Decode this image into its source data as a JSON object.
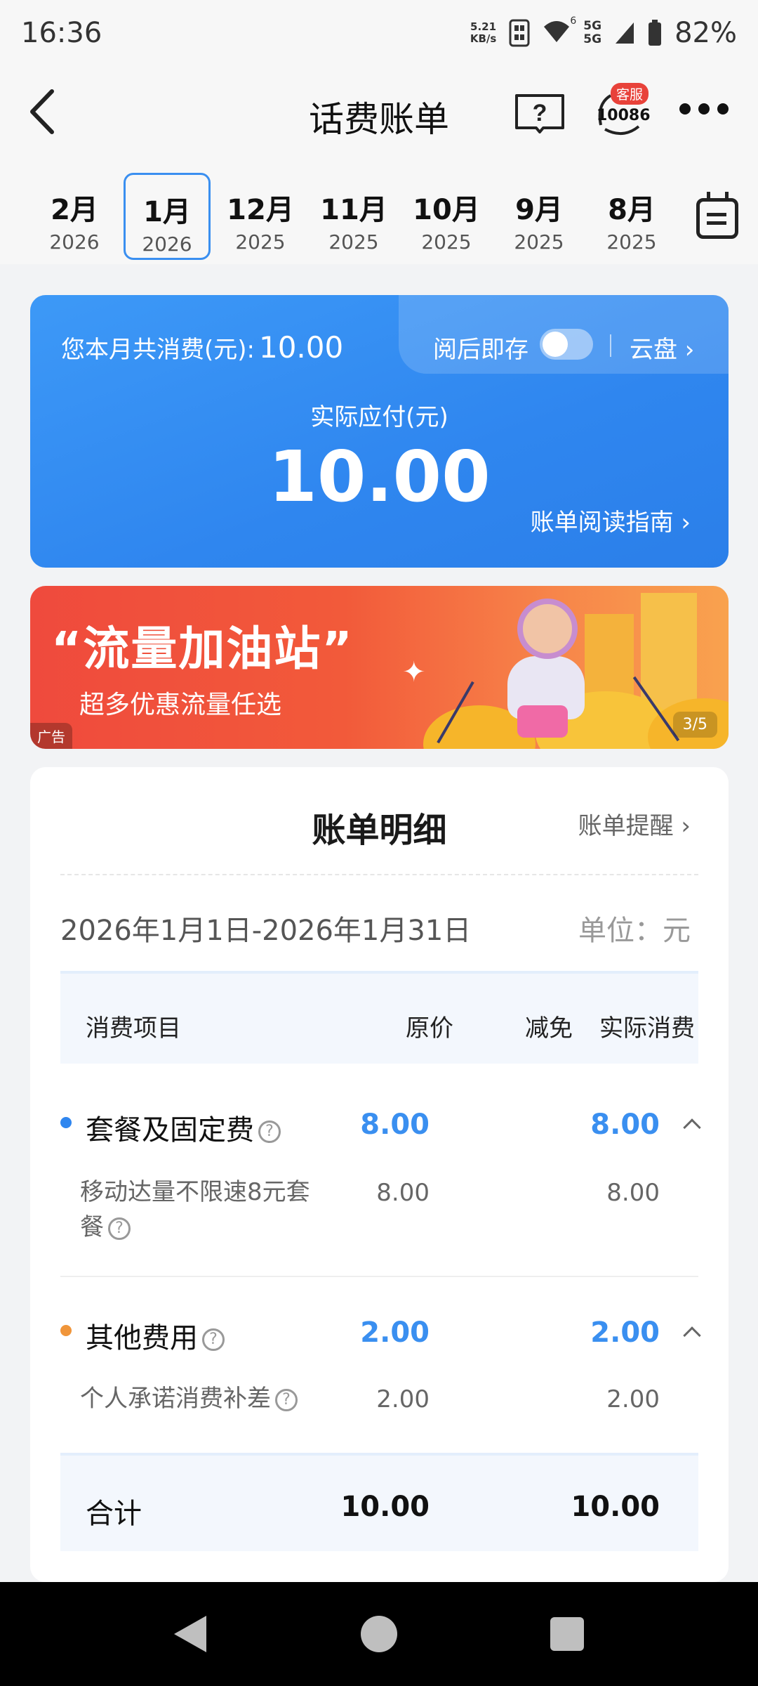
{
  "status_bar": {
    "time": "16:36",
    "net_speed_value": "5.21",
    "net_speed_unit": "KB/s",
    "signal_1": "5G",
    "signal_2": "5G",
    "wifi_badge": "6",
    "battery": "82%"
  },
  "header": {
    "title": "话费账单",
    "cs_badge": "客服",
    "cs_number": "10086"
  },
  "months": [
    {
      "month": "2月",
      "year": "2026"
    },
    {
      "month": "1月",
      "year": "2026"
    },
    {
      "month": "12月",
      "year": "2025"
    },
    {
      "month": "11月",
      "year": "2025"
    },
    {
      "month": "10月",
      "year": "2025"
    },
    {
      "month": "9月",
      "year": "2025"
    },
    {
      "month": "8月",
      "year": "2025"
    }
  ],
  "selected_month_index": 1,
  "summary": {
    "total_label": "您本月共消费(元):",
    "total_value": "10.00",
    "read_save_label": "阅后即存",
    "read_save_on": false,
    "cloud_label": "云盘 ›",
    "actual_label": "实际应付(元)",
    "actual_value": "10.00",
    "guide_label": "账单阅读指南 ›"
  },
  "banner": {
    "title": "“流量加油站”",
    "subtitle": "超多优惠流量任选",
    "ad_tag": "广告",
    "page_indicator": "3/5"
  },
  "detail": {
    "title": "账单明细",
    "reminder_label": "账单提醒 ›",
    "period": "2026年1月1日-2026年1月31日",
    "unit": "单位：元",
    "columns": [
      "消费项目",
      "原价",
      "减免",
      "实际消费"
    ],
    "groups": [
      {
        "name": "套餐及固定费",
        "dot_color": "#2f86ef",
        "original": "8.00",
        "actual": "8.00",
        "items": [
          {
            "name_line1": "移动达量不限速8元套",
            "name_line2": "餐",
            "original": "8.00",
            "actual": "8.00"
          }
        ]
      },
      {
        "name": "其他费用",
        "dot_color": "#f0953a",
        "original": "2.00",
        "actual": "2.00",
        "items": [
          {
            "name_line1": "个人承诺消费补差",
            "name_line2": "",
            "original": "2.00",
            "actual": "2.00"
          }
        ]
      }
    ],
    "total": {
      "label": "合计",
      "original": "10.00",
      "actual": "10.00"
    }
  },
  "colors": {
    "accent": "#3a8ff0",
    "card_blue": "#2f86ef",
    "banner_red": "#ef4a3d"
  }
}
